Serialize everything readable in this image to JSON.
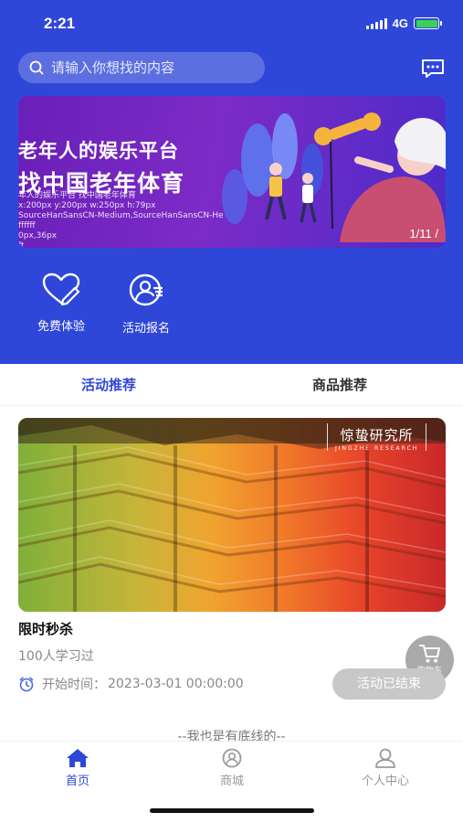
{
  "status_bar": {
    "time": "2:21",
    "network": "4G"
  },
  "search": {
    "placeholder": "请输入你想找的内容",
    "icon": "search-icon"
  },
  "header": {
    "message_icon": "message-icon"
  },
  "banner": {
    "title_line1": "老年人的娱乐平台",
    "title_line2": "找中国老年体育",
    "meta_lines": [
      "年人的娱乐平台 找中国老年体育",
      "x:200px y:200px w:250px h:79px",
      "SourceHanSansCN-Medium,SourceHanSansCN-He",
      "ffffff",
      "0px,36px",
      "ft"
    ],
    "counter": "1/11 /"
  },
  "quick_actions": [
    {
      "label": "免费体验",
      "icon": "heart-pen-icon"
    },
    {
      "label": "活动报名",
      "icon": "user-signup-icon"
    }
  ],
  "tabs": {
    "activity": "活动推荐",
    "goods": "商品推荐",
    "active": "activity"
  },
  "card": {
    "brand_cn": "惊蛰研究所",
    "brand_en": "JINGZHE RESEARCH"
  },
  "course": {
    "title": "限时秒杀",
    "learners": "100人学习过",
    "start_label": "开始时间：",
    "start_value": "2023-03-01 00:00:00",
    "status": "活动已结束"
  },
  "cart": {
    "label": "购物车",
    "icon": "cart-icon"
  },
  "footer_text": "--我也是有底线的--",
  "bottom_nav": {
    "home": "首页",
    "mall": "商城",
    "me": "个人中心",
    "active": "home"
  },
  "colors": {
    "primary": "#2f47d8",
    "disabled_pill": "#c8c8c8",
    "battery": "#39d353"
  }
}
